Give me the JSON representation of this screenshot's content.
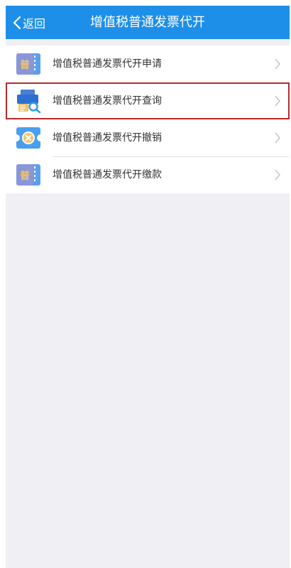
{
  "header": {
    "back_label": "返回",
    "title": "增值税普通发票代开"
  },
  "menu": {
    "items": [
      {
        "label": "增值税普通发票代开申请",
        "icon": "ticket-pu-icon",
        "selected": false
      },
      {
        "label": "增值税普通发票代开查询",
        "icon": "printer-search-icon",
        "selected": true
      },
      {
        "label": "增值税普通发票代开撤销",
        "icon": "ticket-cancel-icon",
        "selected": false
      },
      {
        "label": "增值税普通发票代开缴款",
        "icon": "ticket-pu-icon",
        "selected": false
      }
    ]
  },
  "colors": {
    "navbar": "#1e8fe8",
    "background": "#efeff4",
    "highlight_border": "#b52a2a"
  }
}
